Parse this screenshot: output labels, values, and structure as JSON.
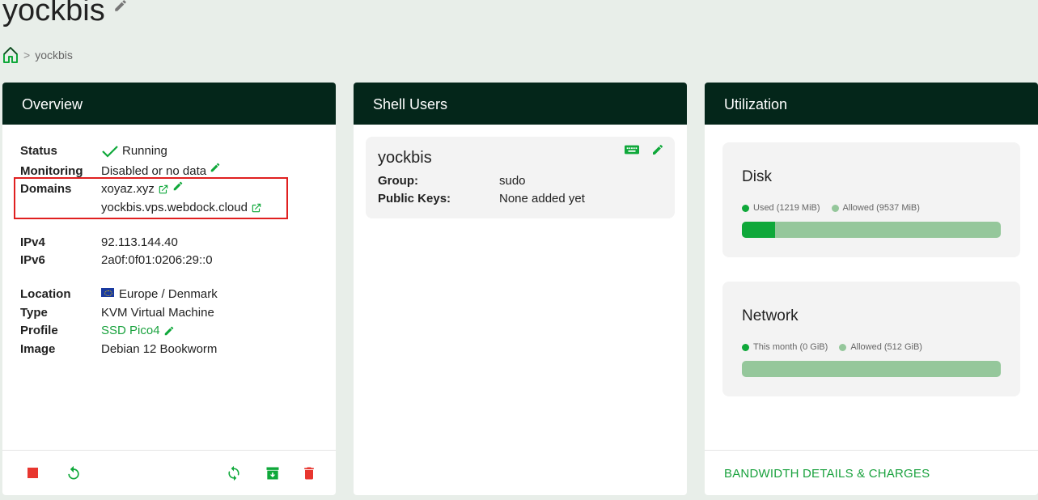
{
  "page": {
    "title": "yockbis"
  },
  "breadcrumb": {
    "current": "yockbis",
    "separator": ">"
  },
  "overview": {
    "header": "Overview",
    "status_label": "Status",
    "status_value": "Running",
    "monitoring_label": "Monitoring",
    "monitoring_value": "Disabled or no data",
    "domains_label": "Domains",
    "domain_1": "xoyaz.xyz",
    "domain_2": "yockbis.vps.webdock.cloud",
    "ipv4_label": "IPv4",
    "ipv4_value": "92.113.144.40",
    "ipv6_label": "IPv6",
    "ipv6_value": "2a0f:0f01:0206:29::0",
    "location_label": "Location",
    "location_value": "Europe / Denmark",
    "type_label": "Type",
    "type_value": "KVM Virtual Machine",
    "profile_label": "Profile",
    "profile_value": "SSD Pico4",
    "image_label": "Image",
    "image_value": "Debian 12 Bookworm"
  },
  "shell": {
    "header": "Shell Users",
    "username": "yockbis",
    "group_label": "Group:",
    "group_value": "sudo",
    "keys_label": "Public Keys:",
    "keys_value": "None added yet"
  },
  "util": {
    "header": "Utilization",
    "disk": {
      "title": "Disk",
      "used_label": "Used (1219 MiB)",
      "allowed_label": "Allowed (9537 MiB)",
      "used_fraction": 0.128
    },
    "network": {
      "title": "Network",
      "used_label": "This month (0 GiB)",
      "allowed_label": "Allowed (512 GiB)",
      "used_fraction": 0
    },
    "footer_link": "BANDWIDTH DETAILS & CHARGES"
  },
  "colors": {
    "accent": "#1aa23e",
    "header_bg": "#04261a",
    "danger": "#e8362f"
  }
}
